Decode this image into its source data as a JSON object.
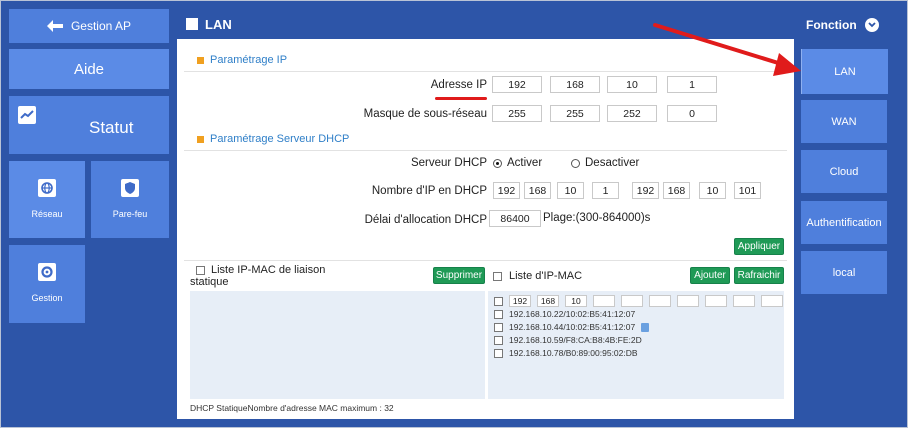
{
  "left": {
    "back_label": "Gestion AP",
    "aide": "Aide",
    "statut": "Statut",
    "reseau": "Réseau",
    "parefeu": "Pare-feu",
    "gestion": "Gestion"
  },
  "panel": {
    "title": "LAN",
    "section_ip": "Paramétrage IP",
    "adresse_ip_label": "Adresse IP",
    "ip": [
      "192",
      "168",
      "10",
      "1"
    ],
    "masque_label": "Masque de sous-réseau",
    "mask": [
      "255",
      "255",
      "252",
      "0"
    ],
    "section_dhcp": "Paramétrage Serveur DHCP",
    "serveur_label": "Serveur DHCP",
    "activer": "Activer",
    "desactiver": "Desactiver",
    "nombre_label": "Nombre d'IP en DHCP",
    "range_start": [
      "192",
      "168",
      "10",
      "1"
    ],
    "range_end": [
      "192",
      "168",
      "10",
      "101"
    ],
    "delai_label": "Délai d'allocation DHCP",
    "delai_value": "86400",
    "plage": "Plage:(300-864000)s",
    "appliquer": "Appliquer",
    "liste_liaison_line1": "Liste IP-MAC de liaison",
    "liste_liaison_line2": "statique",
    "supprimer": "Supprimer",
    "liste_ipmac": "Liste d'IP-MAC",
    "ajouter": "Ajouter",
    "rafraichir": "Rafraichir",
    "list_input": [
      "192",
      "168",
      "10"
    ],
    "list_items": [
      "192.168.10.22/10:02:B5:41:12:07",
      "192.168.10.44/10:02:B5:41:12:07",
      "192.168.10.59/F8:CA:B8:4B:FE:2D",
      "192.168.10.78/B0:89:00:95:02:DB"
    ],
    "footer": "DHCP StatiqueNombre d'adresse MAC maximum : 32"
  },
  "right": {
    "fonction": "Fonction",
    "items": [
      "LAN",
      "WAN",
      "Cloud",
      "Authentification",
      "local"
    ]
  },
  "colors": {
    "background": "#2d55a8",
    "tile": "#4f7fdc",
    "accent_green": "#1f9a56",
    "arrow_red": "#e01b1b"
  }
}
